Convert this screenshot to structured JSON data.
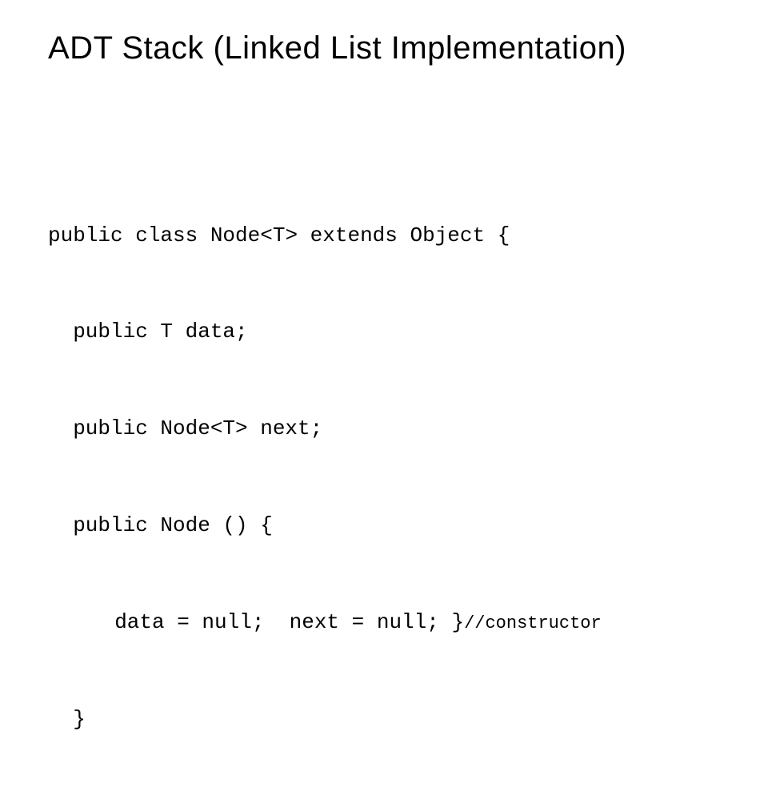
{
  "title": "ADT Stack (Linked List Implementation)",
  "code": {
    "l1": "public class Node<T> extends Object {",
    "l2": "public T data;",
    "l3": "public Node<T> next;",
    "l4": "public Node () {",
    "l5a": "data = null;  next = null; }",
    "l5b": "//constructor",
    "l6": "}"
  }
}
